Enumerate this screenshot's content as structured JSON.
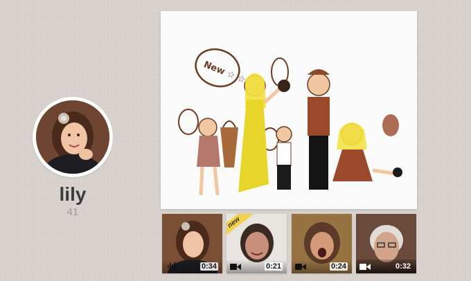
{
  "profile": {
    "name": "lily",
    "count": "41"
  },
  "drawing": {
    "bubble_text": "New ☆ ☆"
  },
  "thumbnails": [
    {
      "type": "audio",
      "icon": "waveform-icon",
      "duration": "0:34"
    },
    {
      "type": "video",
      "icon": "video-camera-icon",
      "duration": "0:21",
      "badge": "new"
    },
    {
      "type": "video",
      "icon": "video-camera-icon",
      "duration": "0:24"
    },
    {
      "type": "video",
      "icon": "video-camera-icon",
      "duration": "0:32"
    }
  ],
  "colors": {
    "background": "#d7d0cc",
    "ribbon": "#f2d24a"
  }
}
